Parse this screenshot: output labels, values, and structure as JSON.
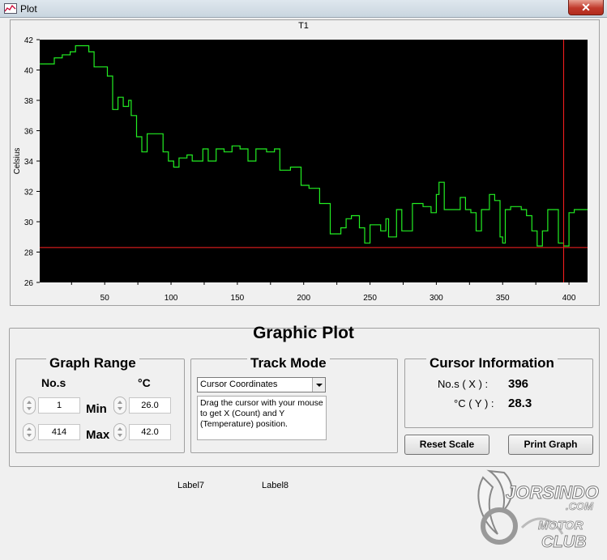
{
  "window": {
    "title": "Plot",
    "close_label": "✕"
  },
  "chart_data": {
    "type": "line",
    "title": "T1",
    "xlabel": "",
    "ylabel": "Celsius",
    "xlim": [
      1,
      414
    ],
    "ylim": [
      26,
      42
    ],
    "xticks": [
      50,
      100,
      150,
      200,
      250,
      300,
      350,
      400
    ],
    "yticks": [
      26,
      28,
      30,
      32,
      34,
      36,
      38,
      40,
      42
    ],
    "background": "#000000",
    "line_color": "#22ee22",
    "cursor_color": "#ff2020",
    "cursor": {
      "x": 396,
      "y": 28.3
    },
    "grid": false,
    "series": [
      {
        "values": [
          [
            1,
            40.4
          ],
          [
            12,
            40.4
          ],
          [
            12,
            40.8
          ],
          [
            18,
            40.8
          ],
          [
            18,
            41.0
          ],
          [
            24,
            41.0
          ],
          [
            24,
            41.2
          ],
          [
            28,
            41.2
          ],
          [
            28,
            41.6
          ],
          [
            38,
            41.6
          ],
          [
            38,
            41.2
          ],
          [
            42,
            41.2
          ],
          [
            42,
            40.2
          ],
          [
            52,
            40.2
          ],
          [
            52,
            39.6
          ],
          [
            56,
            39.6
          ],
          [
            56,
            37.4
          ],
          [
            60,
            37.4
          ],
          [
            60,
            38.2
          ],
          [
            64,
            38.2
          ],
          [
            64,
            37.6
          ],
          [
            68,
            37.6
          ],
          [
            68,
            38.0
          ],
          [
            70,
            38.0
          ],
          [
            70,
            37.0
          ],
          [
            74,
            37.0
          ],
          [
            74,
            35.6
          ],
          [
            78,
            35.6
          ],
          [
            78,
            34.6
          ],
          [
            82,
            34.6
          ],
          [
            82,
            35.8
          ],
          [
            94,
            35.8
          ],
          [
            94,
            34.6
          ],
          [
            98,
            34.6
          ],
          [
            98,
            34.0
          ],
          [
            102,
            34.0
          ],
          [
            102,
            33.6
          ],
          [
            106,
            33.6
          ],
          [
            106,
            34.2
          ],
          [
            112,
            34.2
          ],
          [
            112,
            34.4
          ],
          [
            116,
            34.4
          ],
          [
            116,
            34.0
          ],
          [
            124,
            34.0
          ],
          [
            124,
            34.8
          ],
          [
            128,
            34.8
          ],
          [
            128,
            34.0
          ],
          [
            134,
            34.0
          ],
          [
            134,
            34.8
          ],
          [
            140,
            34.8
          ],
          [
            140,
            34.6
          ],
          [
            146,
            34.6
          ],
          [
            146,
            35.0
          ],
          [
            152,
            35.0
          ],
          [
            152,
            34.8
          ],
          [
            158,
            34.8
          ],
          [
            158,
            34.0
          ],
          [
            164,
            34.0
          ],
          [
            164,
            34.8
          ],
          [
            172,
            34.8
          ],
          [
            172,
            34.6
          ],
          [
            178,
            34.6
          ],
          [
            178,
            34.8
          ],
          [
            182,
            34.8
          ],
          [
            182,
            33.4
          ],
          [
            190,
            33.4
          ],
          [
            190,
            33.6
          ],
          [
            198,
            33.6
          ],
          [
            198,
            32.4
          ],
          [
            204,
            32.4
          ],
          [
            204,
            32.2
          ],
          [
            212,
            32.2
          ],
          [
            212,
            31.2
          ],
          [
            220,
            31.2
          ],
          [
            220,
            29.2
          ],
          [
            228,
            29.2
          ],
          [
            228,
            29.6
          ],
          [
            232,
            29.6
          ],
          [
            232,
            30.2
          ],
          [
            236,
            30.2
          ],
          [
            236,
            30.4
          ],
          [
            242,
            30.4
          ],
          [
            242,
            29.6
          ],
          [
            246,
            29.6
          ],
          [
            246,
            28.6
          ],
          [
            250,
            28.6
          ],
          [
            250,
            29.8
          ],
          [
            258,
            29.8
          ],
          [
            258,
            29.4
          ],
          [
            262,
            29.4
          ],
          [
            262,
            30.2
          ],
          [
            264,
            30.2
          ],
          [
            264,
            29.0
          ],
          [
            270,
            29.0
          ],
          [
            270,
            30.8
          ],
          [
            274,
            30.8
          ],
          [
            274,
            29.4
          ],
          [
            282,
            29.4
          ],
          [
            282,
            31.2
          ],
          [
            290,
            31.2
          ],
          [
            290,
            31.0
          ],
          [
            296,
            31.0
          ],
          [
            296,
            30.6
          ],
          [
            300,
            30.6
          ],
          [
            300,
            31.8
          ],
          [
            302,
            31.8
          ],
          [
            302,
            32.6
          ],
          [
            306,
            32.6
          ],
          [
            306,
            30.8
          ],
          [
            318,
            30.8
          ],
          [
            318,
            31.6
          ],
          [
            322,
            31.6
          ],
          [
            322,
            30.8
          ],
          [
            326,
            30.8
          ],
          [
            326,
            30.6
          ],
          [
            330,
            30.6
          ],
          [
            330,
            29.4
          ],
          [
            334,
            29.4
          ],
          [
            334,
            30.8
          ],
          [
            340,
            30.8
          ],
          [
            340,
            31.8
          ],
          [
            344,
            31.8
          ],
          [
            344,
            31.4
          ],
          [
            348,
            31.4
          ],
          [
            348,
            29.0
          ],
          [
            350,
            29.0
          ],
          [
            350,
            28.6
          ],
          [
            352,
            28.6
          ],
          [
            352,
            30.8
          ],
          [
            356,
            30.8
          ],
          [
            356,
            31.0
          ],
          [
            364,
            31.0
          ],
          [
            364,
            30.8
          ],
          [
            368,
            30.8
          ],
          [
            368,
            30.4
          ],
          [
            372,
            30.4
          ],
          [
            372,
            29.4
          ],
          [
            376,
            29.4
          ],
          [
            376,
            28.4
          ],
          [
            380,
            28.4
          ],
          [
            380,
            29.4
          ],
          [
            384,
            29.4
          ],
          [
            384,
            30.8
          ],
          [
            392,
            30.8
          ],
          [
            392,
            28.6
          ],
          [
            396,
            28.6
          ],
          [
            396,
            28.4
          ],
          [
            400,
            28.4
          ],
          [
            400,
            30.6
          ],
          [
            404,
            30.6
          ],
          [
            404,
            30.8
          ],
          [
            414,
            30.8
          ]
        ]
      }
    ]
  },
  "graphic_plot": {
    "title": "Graphic Plot",
    "graph_range": {
      "title": "Graph Range",
      "col_count": "No.s",
      "col_temp": "°C",
      "min_label": "Min",
      "max_label": "Max",
      "count_min": "1",
      "count_max": "414",
      "temp_min": "26.0",
      "temp_max": "42.0"
    },
    "track_mode": {
      "title": "Track Mode",
      "selected": "Cursor Coordinates",
      "help": "Drag the cursor with your mouse to get X (Count) and Y (Temperature) position."
    },
    "cursor_info": {
      "title": "Cursor Information",
      "x_label": "No.s ( X ) :",
      "x_value": "396",
      "y_label": "°C ( Y ) :",
      "y_value": "28.3"
    },
    "buttons": {
      "reset": "Reset Scale",
      "print": "Print Graph"
    }
  },
  "labels": {
    "label7": "Label7",
    "label8": "Label8"
  },
  "watermark": {
    "brand": "JORSINDO",
    "domain": ".COM",
    "motor": "MOTOR",
    "club": "CLUB"
  }
}
